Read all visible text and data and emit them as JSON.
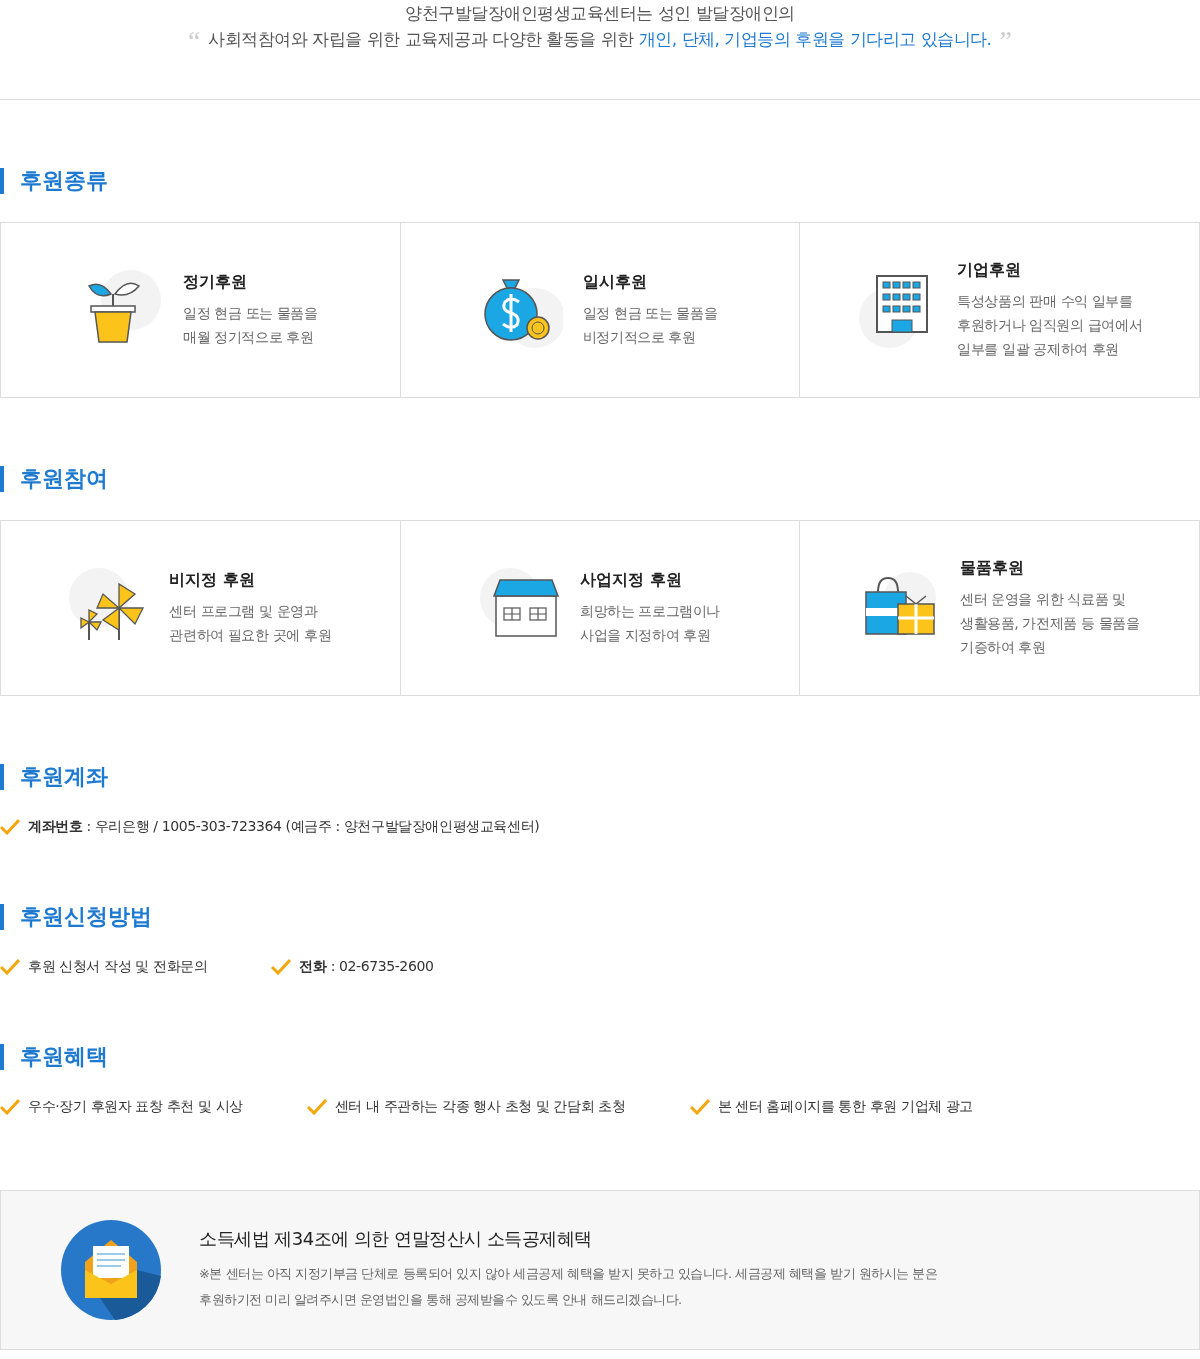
{
  "intro": {
    "open_quote": "“",
    "line_1": "양천구발달장애인평생교육센터는 성인 발달장애인의",
    "line_2": "사회적참여와 자립을 위한 교육제공과 다양한 활동을 위한",
    "line_2_highlight": "개인, 단체, 기업등의 후원을 기다리고 있습니다.",
    "close_quote": "”"
  },
  "sections": [
    {
      "kind": "cards",
      "heading": "후원종류",
      "cards": [
        {
          "kind": "plant",
          "title": "정기후원",
          "description": [
            "일정 현금 또는 물품을",
            "매월 정기적으로 후원"
          ]
        },
        {
          "kind": "money",
          "title": "일시후원",
          "description": [
            "일정 현금 또는 물품을",
            "비정기적으로 후원"
          ]
        },
        {
          "kind": "building",
          "title": "기업후원",
          "description": [
            "특성상품의 판매 수익 일부를",
            "후원하거나 임직원의 급여에서",
            "일부를 일괄 공제하여 후원"
          ]
        }
      ]
    },
    {
      "kind": "cards",
      "heading": "후원참여",
      "cards": [
        {
          "kind": "pinwheel",
          "title": "비지정 후원",
          "description": [
            "센터 프로그램 및 운영과",
            "관련하여 필요한 곳에 후원"
          ]
        },
        {
          "kind": "house",
          "title": "사업지정 후원",
          "description": [
            "희망하는 프로그램이나",
            "사업을 지정하여 후원"
          ]
        },
        {
          "kind": "gift",
          "title": "물품후원",
          "description": [
            "센터 운영을 위한 식료품 및",
            "생활용품, 가전제품 등 물품을",
            "기증하여 후원"
          ]
        }
      ]
    },
    {
      "kind": "checks",
      "heading": "후원계좌",
      "items": [
        "**계좌번호** :  우리은행 / 1005-303-723364 (예금주 : 양천구발달장애인평생교육센터)"
      ]
    },
    {
      "kind": "checks",
      "heading": "후원신청방법",
      "items": [
        "후원 신청서 작성 및 전화문의",
        "**전화** : 02-6735-2600"
      ]
    },
    {
      "kind": "checks",
      "heading": "후원혜택",
      "items": [
        "우수·장기 후원자 표창 추천 및 시상",
        "센터 내 주관하는 각종 행사 초청 및 간담회 초청",
        "본 센터 홈페이지를 통한 후원 기업체 광고"
      ]
    }
  ],
  "notice": {
    "title": "소득세법 제34조에 의한 연말정산시 소득공제혜택",
    "lines": [
      "※본 센터는 아직 지정기부금 단체로 등록되어 있지 않아 세금공제 혜택을 받지 못하고 있습니다. 세금공제 혜택을 받기 원하시는 분은",
      "후원하기전 미리 알려주시면 운영법인을 통해 공제받을수 있도록 안내 해드리겠습니다."
    ]
  }
}
